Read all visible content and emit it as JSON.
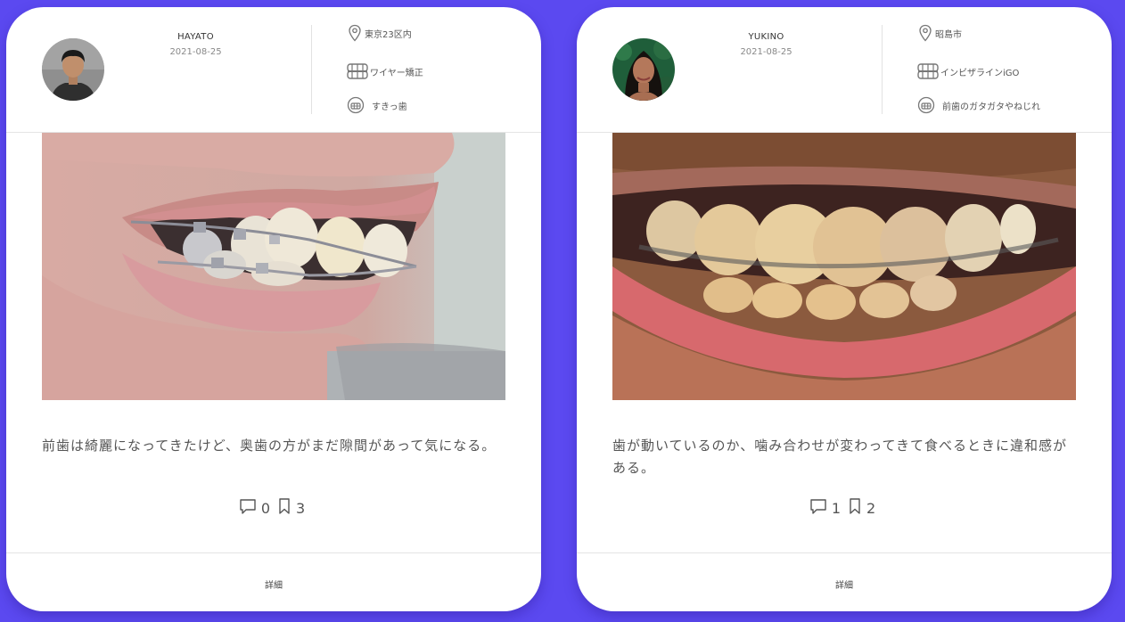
{
  "cards": [
    {
      "username": "HAYATO",
      "date": "2021-08-25",
      "location": "東京23区内",
      "treatment": "ワイヤー矯正",
      "condition": "すきっ歯",
      "comment": "前歯は綺麗になってきたけど、奥歯の方がまだ隙間があって気になる。",
      "comments_count": "0",
      "bookmarks_count": "3",
      "detail_label": "詳細"
    },
    {
      "username": "YUKINO",
      "date": "2021-08-25",
      "location": "昭島市",
      "treatment": "インビザラインiGO",
      "condition": "前歯のガタガタやねじれ",
      "comment": "歯が動いているのか、噛み合わせが変わってきて食べるときに違和感がある。",
      "comments_count": "1",
      "bookmarks_count": "2",
      "detail_label": "詳細"
    }
  ],
  "icons": {
    "location": "map-pin-icon",
    "treatment": "braces-icon",
    "condition": "teeth-icon",
    "comments": "comment-bubble-icon",
    "bookmarks": "bookmark-icon"
  },
  "colors": {
    "background": "#5b49f0",
    "card": "#ffffff"
  }
}
